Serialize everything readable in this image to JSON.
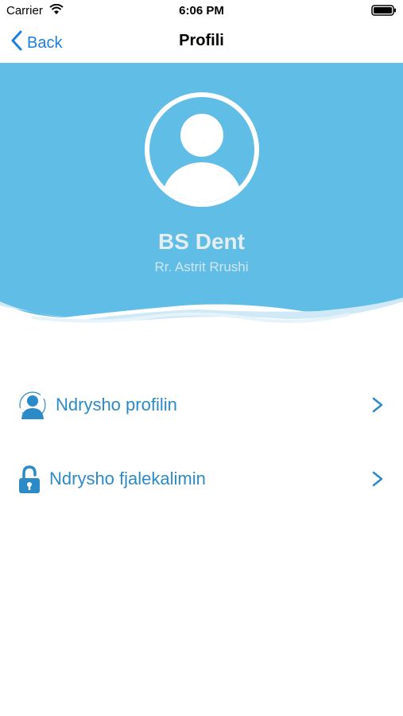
{
  "status_bar": {
    "carrier": "Carrier",
    "time": "6:06 PM"
  },
  "nav": {
    "back_label": "Back",
    "title": "Profili"
  },
  "profile": {
    "name": "BS Dent",
    "address": "Rr. Astrit Rrushi"
  },
  "menu": {
    "edit_profile": "Ndrysho profilin",
    "change_password": "Ndrysho fjalekalimin"
  },
  "colors": {
    "header_bg": "#5fbde6",
    "accent": "#2c8ac6",
    "link": "#1a7fe0"
  },
  "icons": {
    "wifi": "wifi-icon",
    "battery": "battery-icon",
    "back": "chevron-left-icon",
    "avatar": "user-avatar-icon",
    "edit_profile": "user-icon",
    "change_password": "unlock-icon",
    "chevron": "chevron-right-icon"
  }
}
